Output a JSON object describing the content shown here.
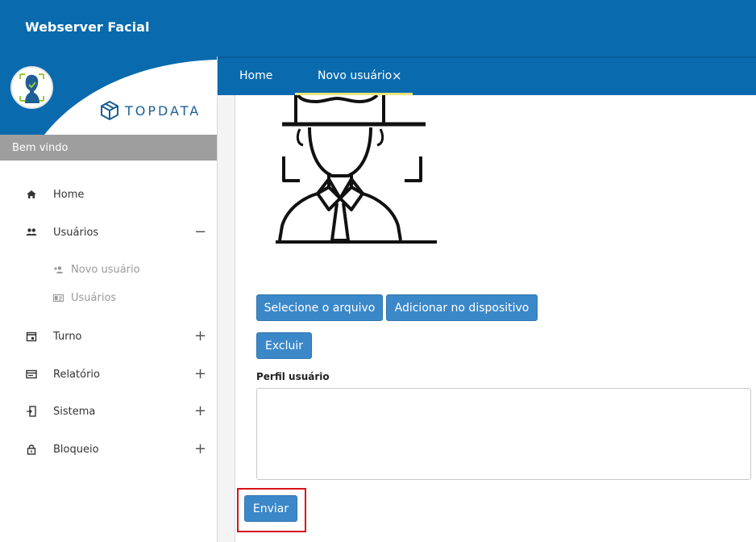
{
  "app": {
    "title": "Webserver Facial"
  },
  "sidebar": {
    "brand": "TOPDATA",
    "welcome": "Bem vindo",
    "menu": [
      {
        "label": "Home",
        "icon": "home-icon",
        "toggle": ""
      },
      {
        "label": "Usuários",
        "icon": "users-icon",
        "toggle": "−"
      },
      {
        "label": "Turno",
        "icon": "calendar-icon",
        "toggle": "+"
      },
      {
        "label": "Relatório",
        "icon": "report-icon",
        "toggle": "+"
      },
      {
        "label": "Sistema",
        "icon": "system-icon",
        "toggle": "+"
      },
      {
        "label": "Bloqueio",
        "icon": "lock-icon",
        "toggle": "+"
      }
    ],
    "submenu": [
      {
        "label": "Novo usuário",
        "icon": "add-user-icon"
      },
      {
        "label": "Usuários",
        "icon": "id-card-icon"
      }
    ]
  },
  "tabs": [
    {
      "label": "Home"
    },
    {
      "label": "Novo usuário",
      "close": "×"
    }
  ],
  "form": {
    "select_file_button": "Selecione o arquivo",
    "add_device_button": "Adicionar no dispositivo",
    "delete_button": "Excluir",
    "profile_label": "Perfil usuário",
    "profile_value": "",
    "submit_button": "Enviar"
  },
  "colors": {
    "header_blue": "#0a6aae",
    "button_blue": "#3b88c9",
    "tab_underline": "#f2e47a",
    "highlight_red": "#d8121b"
  }
}
